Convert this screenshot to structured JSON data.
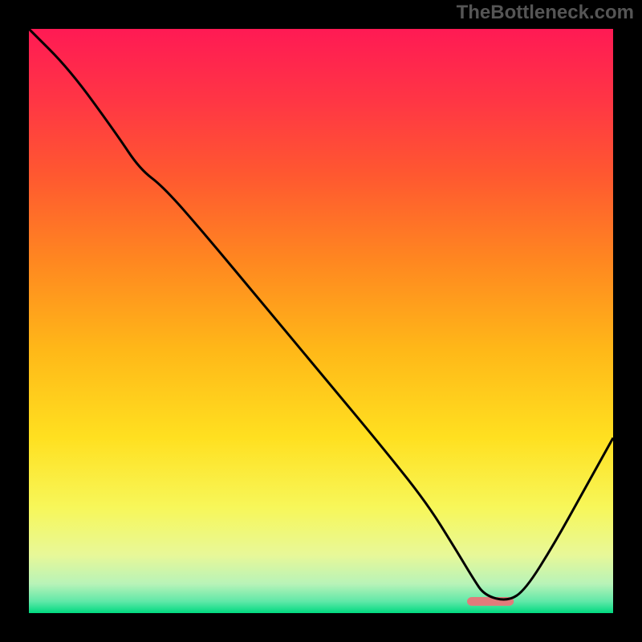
{
  "watermark": "TheBottleneck.com",
  "chart_data": {
    "type": "line",
    "title": "",
    "xlabel": "",
    "ylabel": "",
    "xlim": [
      0,
      100
    ],
    "ylim": [
      0,
      100
    ],
    "marker": {
      "x": 79,
      "y": 2,
      "width": 8,
      "height": 1.5,
      "color": "#e27b7b"
    },
    "curve_x": [
      0,
      7,
      15,
      19,
      23,
      30,
      40,
      50,
      60,
      68,
      73,
      76,
      78,
      82,
      85,
      90,
      95,
      100
    ],
    "curve_y": [
      100,
      93,
      82,
      76,
      73,
      65,
      53,
      41,
      29,
      19,
      11,
      6,
      3,
      2,
      4,
      12,
      21,
      30
    ],
    "gradient_stops": [
      {
        "offset": 0,
        "color": "#ff1a54"
      },
      {
        "offset": 12,
        "color": "#ff3545"
      },
      {
        "offset": 25,
        "color": "#ff5830"
      },
      {
        "offset": 40,
        "color": "#ff8820"
      },
      {
        "offset": 55,
        "color": "#ffb818"
      },
      {
        "offset": 70,
        "color": "#ffe020"
      },
      {
        "offset": 82,
        "color": "#f7f75a"
      },
      {
        "offset": 90,
        "color": "#e8f898"
      },
      {
        "offset": 95,
        "color": "#b8f3b8"
      },
      {
        "offset": 98,
        "color": "#60e8a8"
      },
      {
        "offset": 100,
        "color": "#00d980"
      }
    ],
    "frame_thickness": 4.5,
    "frame_color": "#000000"
  }
}
